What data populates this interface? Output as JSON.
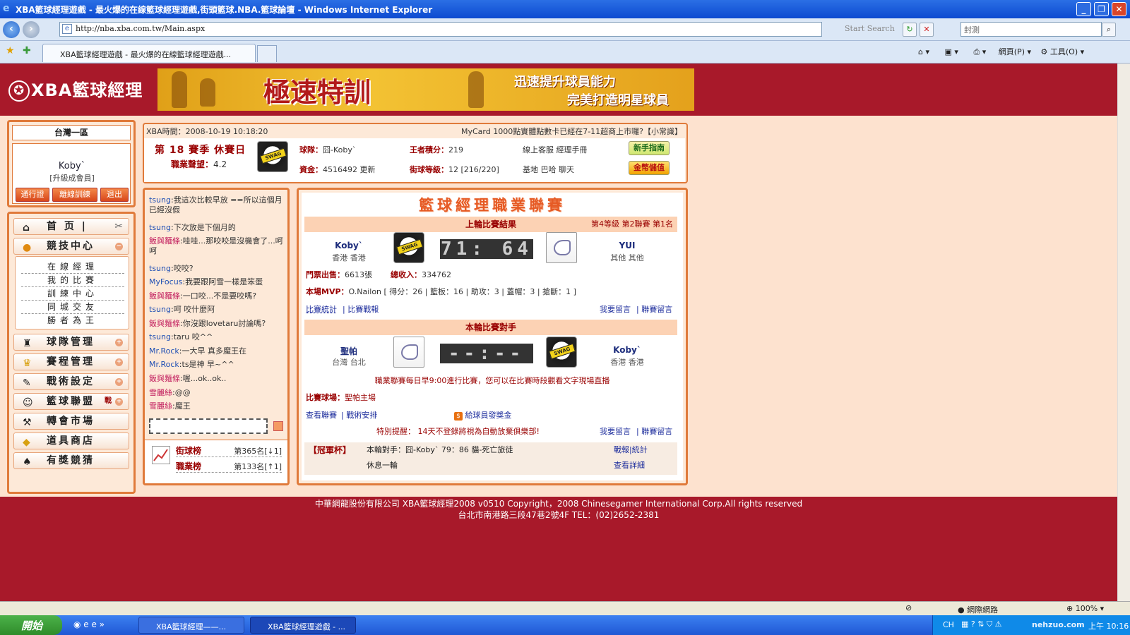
{
  "window": {
    "title": "XBA籃球經理遊戲 - 最火爆的在線籃球經理遊戲,街頭籃球.NBA.籃球論壇 - Windows Internet Explorer"
  },
  "browser": {
    "url": "http://nba.xba.com.tw/Main.aspx",
    "search_hint": "Start Search",
    "search_box": "封測",
    "tab_title": "XBA籃球經理遊戲 - 最火爆的在線籃球經理遊戲...",
    "cmd_page": "網頁(P)",
    "cmd_tools": "工具(O)"
  },
  "site": {
    "logo": "XBA籃球經理",
    "banner": {
      "main": "極速特訓",
      "line1": "迅速提升球員能力",
      "line2": "完美打造明星球員"
    },
    "zone": "台灣一區",
    "user": {
      "name": "Koby`",
      "role": "[升級成會員]",
      "btn1": "通行證",
      "btn2": "離線訓練",
      "btn3": "退出"
    },
    "menu": [
      {
        "label": "首 页",
        "icon": "home-icon"
      },
      {
        "label": "競技中心",
        "icon": "basketball-icon"
      },
      {
        "label": "球隊管理",
        "icon": "team-icon"
      },
      {
        "label": "賽程管理",
        "icon": "trophy-icon"
      },
      {
        "label": "戰術設定",
        "icon": "tactics-icon"
      },
      {
        "label": "籃球聯盟",
        "icon": "league-icon",
        "tag": "戰"
      },
      {
        "label": "轉會市場",
        "icon": "transfer-icon"
      },
      {
        "label": "道具商店",
        "icon": "shop-icon"
      },
      {
        "label": "有獎競猜",
        "icon": "guess-icon"
      }
    ],
    "submenu": [
      "在線經理",
      "我的比賽",
      "訓練中心",
      "同城交友",
      "勝者為王"
    ],
    "info": {
      "time": "XBA時間：2008-10-19 10:18:20",
      "notice": "MyCard 1000點實體點數卡已經在7-11超商上市囉?【小常識】",
      "season": "第 18 賽季 休賽日",
      "career_label": "職業聲望：",
      "career_value": "4.2",
      "team_label": "球隊：",
      "team_value": "囧-Koby`",
      "funds_label": "資金：",
      "funds_value": "4516492",
      "funds_update": "更新",
      "king_label": "王者積分：",
      "king_value": "219",
      "street_label": "街球等級：",
      "street_value": "12 [216/220]",
      "links1": "線上客服  經理手冊",
      "links2": "基地  巴哈  聊天",
      "guide_btn": "新手指南",
      "gold_btn": "金幣儲值"
    },
    "chat": [
      {
        "name": "tsung",
        "text": ":我這次比較早放 ==所以這個月已經沒假"
      },
      {
        "name": "tsung",
        "text": ":下次放是下個月的"
      },
      {
        "name": "飯與麵條",
        "text": ":哇哇...那咬咬是沒機會了...呵呵"
      },
      {
        "name": "tsung",
        "text": ":咬咬?"
      },
      {
        "name": "MyFocus",
        "text": ":我要跟阿雪一樣是笨蛋"
      },
      {
        "name": "飯與麵條",
        "text": ":一口咬...不是要咬嗎?"
      },
      {
        "name": "tsung",
        "text": ":呵 咬什麼阿"
      },
      {
        "name": "飯與麵條",
        "text": ":你沒跟lovetaru討論嗎?"
      },
      {
        "name": "tsung",
        "text": ":taru 咬^^"
      },
      {
        "name": "Mr.Rock",
        "text": ":一大早 真多魔王在"
      },
      {
        "name": "Mr.Rock",
        "text": ":ts是神 早~^^"
      },
      {
        "name": "飯與麵條",
        "text": ":喔...ok..ok.."
      },
      {
        "name": "雪麗絲",
        "text": ":@@"
      },
      {
        "name": "雪麗絲",
        "text": ":魔王"
      }
    ],
    "ranks": [
      {
        "label": "街球榜",
        "value": "第365名[↓1]"
      },
      {
        "label": "職業榜",
        "value": "第133名[↑1]"
      }
    ],
    "league": {
      "title": "籃球經理職業聯賽",
      "last_header": "上輪比賽結果",
      "last_rank": "第4等級  第2聯賽  第1名",
      "home_name": "Koby`",
      "home_loc": "香港 香港",
      "score": "71: 64",
      "away_name": "YUI",
      "away_loc": "其他 其他",
      "tickets_label": "門票出售：",
      "tickets_value": "6613張",
      "income_label": "總收入：",
      "income_value": "334762",
      "mvp_label": "本場MVP：",
      "mvp_value": "O.Nailon [ 得分：26 | 籃板：16 | 助攻：3 | 蓋帽：3 | 搶斷：1 ]",
      "stats_link": "比賽統計",
      "report_link": "比賽戰報",
      "leave_msg": "我要留言",
      "league_msg": "聯賽留言",
      "next_header": "本輪比賽對手",
      "next_home_name": "聖帕",
      "next_home_loc": "台灣 台北",
      "next_score": "--:--",
      "next_away_name": "Koby`",
      "next_away_loc": "香港 香港",
      "schedule_note": "職業聯賽每日早9:00進行比賽，您可以在比賽時段觀看文字現場直播",
      "venue_label": "比賽球場：",
      "venue_value": "聖帕主場",
      "view_league": "查看聯賽",
      "tactic_arrange": "戰術安排",
      "bonus": "給球員發獎金",
      "warning_label": "特別提醒：",
      "warning_text": "14天不登錄將視為自動放棄俱樂部!",
      "leave_msg2": "我要留言",
      "league_msg2": "聯賽留言",
      "cup_label": "【冠軍杯】",
      "cup_line1": "本輪對手：囧-Koby` 79：86 貓-死亡旅徒",
      "cup_line2": "休息一輪",
      "cup_report": "戰報|統計",
      "cup_detail": "查看詳細"
    },
    "footer": {
      "line1": "中華網龍股份有限公司  XBA籃球經理2008 v0510     Copyright，2008 Chinesegamer International Corp.All rights reserved",
      "line2": "台北市南港路三段47巷2號4F TEL：(02)2652-2381"
    }
  },
  "status": {
    "zone": "網際網路",
    "zoom": "100%"
  },
  "taskbar": {
    "start": "開始",
    "task1": "XBA籃球經理——...",
    "task2": "XBA籃球經理遊戲 - ...",
    "ime": "CH",
    "time": "上午 10:16",
    "watermark": "nehzuo.com"
  }
}
